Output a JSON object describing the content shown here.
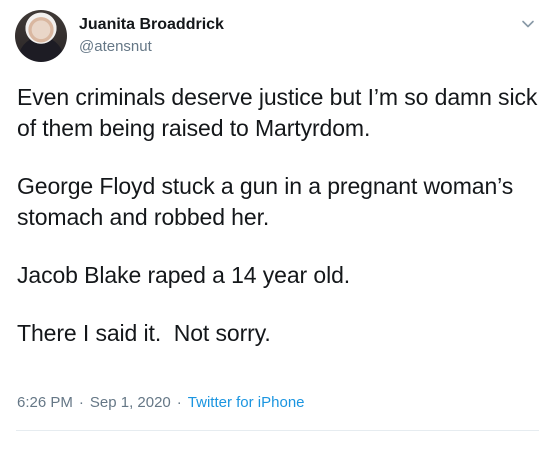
{
  "author": {
    "display_name": "Juanita Broaddrick",
    "handle": "@atensnut"
  },
  "menu": {
    "icon": "chevron-down-icon"
  },
  "tweet": {
    "paragraphs": [
      "Even criminals deserve justice but I’m so damn sick of them being raised to Martyrdom.",
      "George Floyd stuck a gun in a pregnant woman’s stomach and robbed her.",
      "Jacob Blake raped a 14 year old.",
      "There I said it.  Not sorry."
    ],
    "time": "6:26 PM",
    "separator": "·",
    "date": "Sep 1, 2020",
    "source": "Twitter for iPhone"
  },
  "colors": {
    "text": "#14171a",
    "secondary": "#657786",
    "link": "#1b95e0",
    "divider": "#e6ecf0"
  }
}
